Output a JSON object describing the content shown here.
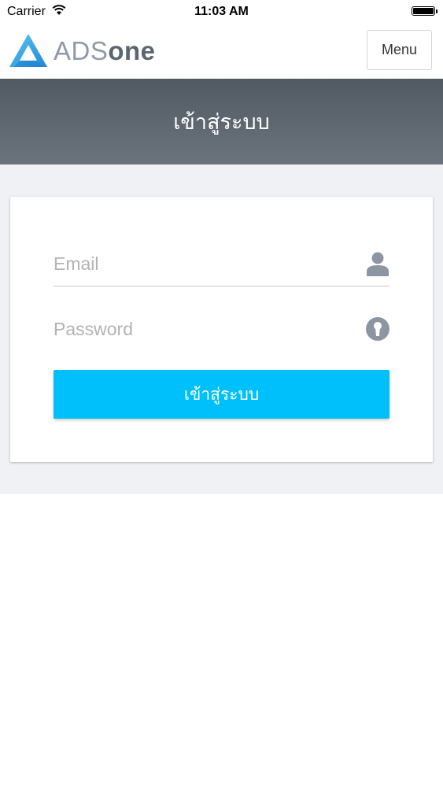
{
  "status_bar": {
    "carrier": "Carrier",
    "time": "11:03 AM",
    "icons": [
      "wifi-icon",
      "battery-icon"
    ]
  },
  "navbar": {
    "logo_ads": "ADS",
    "logo_one": "one",
    "menu_label": "Menu",
    "brand_color": "#3aa8e8"
  },
  "header": {
    "title": "เข้าสู่ระบบ"
  },
  "login_form": {
    "email_placeholder": "Email",
    "email_icon": "user-icon",
    "password_placeholder": "Password",
    "password_icon": "keyhole-icon",
    "submit_label": "เข้าสู่ระบบ",
    "submit_color": "#00c0fb"
  }
}
